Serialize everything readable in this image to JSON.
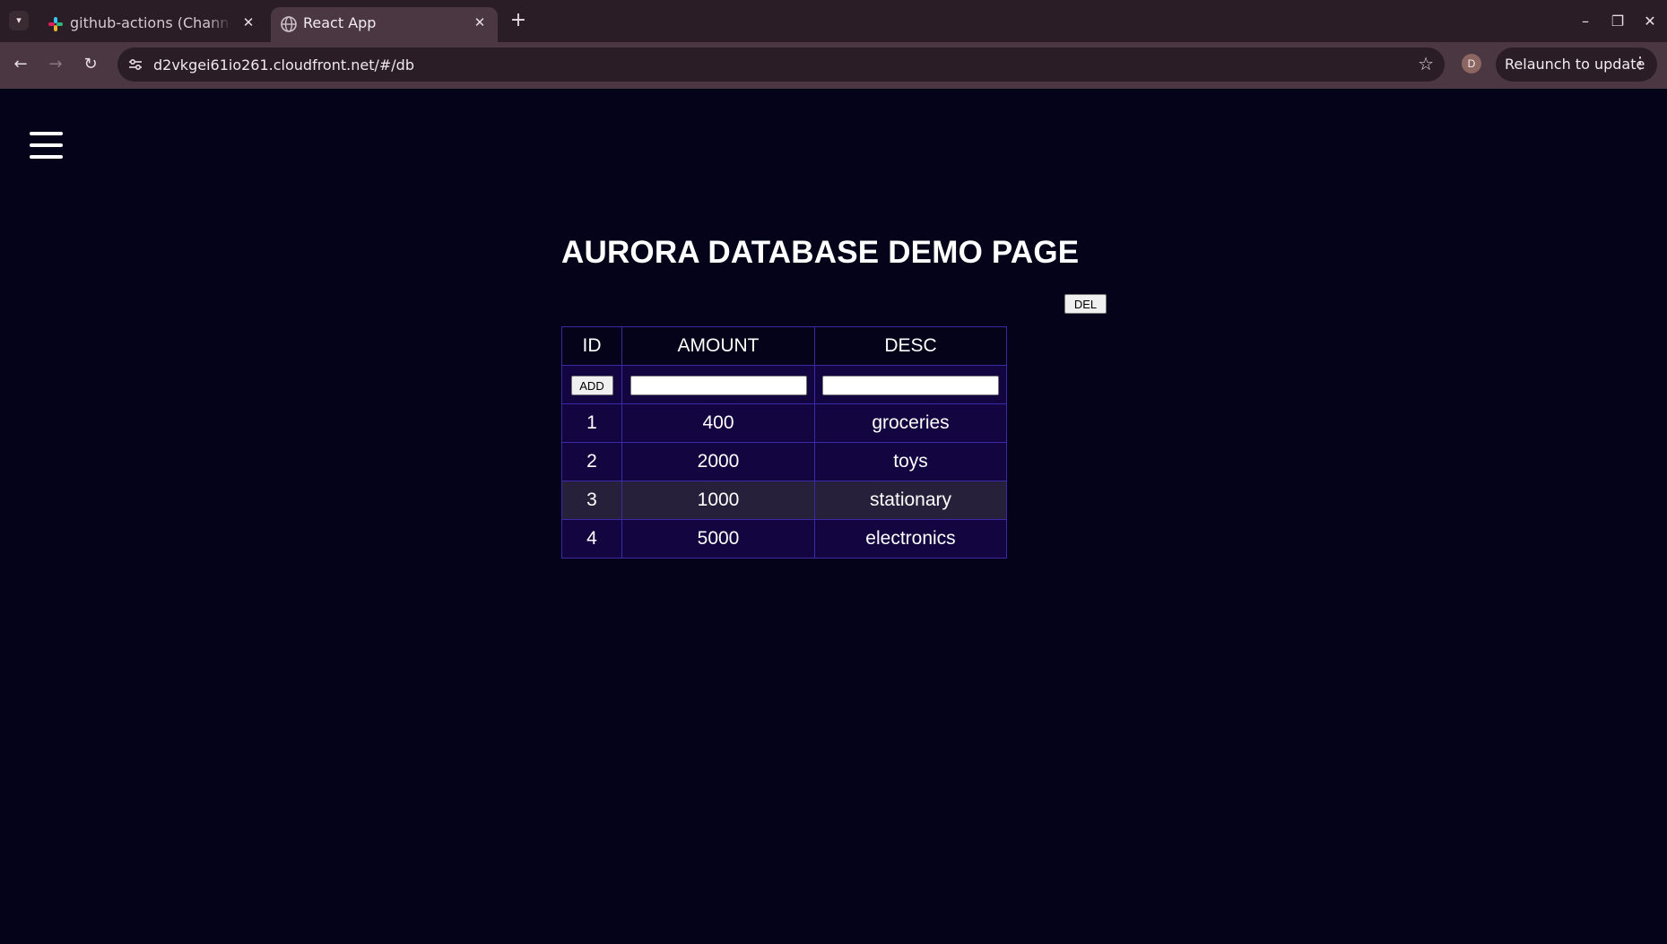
{
  "browser": {
    "tabs": [
      {
        "title": "github-actions (Channel) - Slack",
        "active": false
      },
      {
        "title": "React App",
        "active": true
      }
    ],
    "url": "d2vkgei61io261.cloudfront.net/#/db",
    "profile_initial": "D",
    "relaunch_label": "Relaunch to update"
  },
  "page": {
    "title": "AURORA DATABASE DEMO PAGE",
    "del_label": "DEL",
    "add_label": "ADD",
    "table": {
      "headers": [
        "ID",
        "AMOUNT",
        "DESC"
      ],
      "rows": [
        {
          "id": "1",
          "amount": "400",
          "desc": "groceries"
        },
        {
          "id": "2",
          "amount": "2000",
          "desc": "toys"
        },
        {
          "id": "3",
          "amount": "1000",
          "desc": "stationary"
        },
        {
          "id": "4",
          "amount": "5000",
          "desc": "electronics"
        }
      ],
      "highlighted_row": 3
    },
    "inputs": {
      "amount_value": "",
      "desc_value": ""
    }
  },
  "colors": {
    "page_bg": "#05031a",
    "cell_bg": "#120540",
    "border": "#3b2aa8",
    "row_highlight": "#27203a"
  }
}
